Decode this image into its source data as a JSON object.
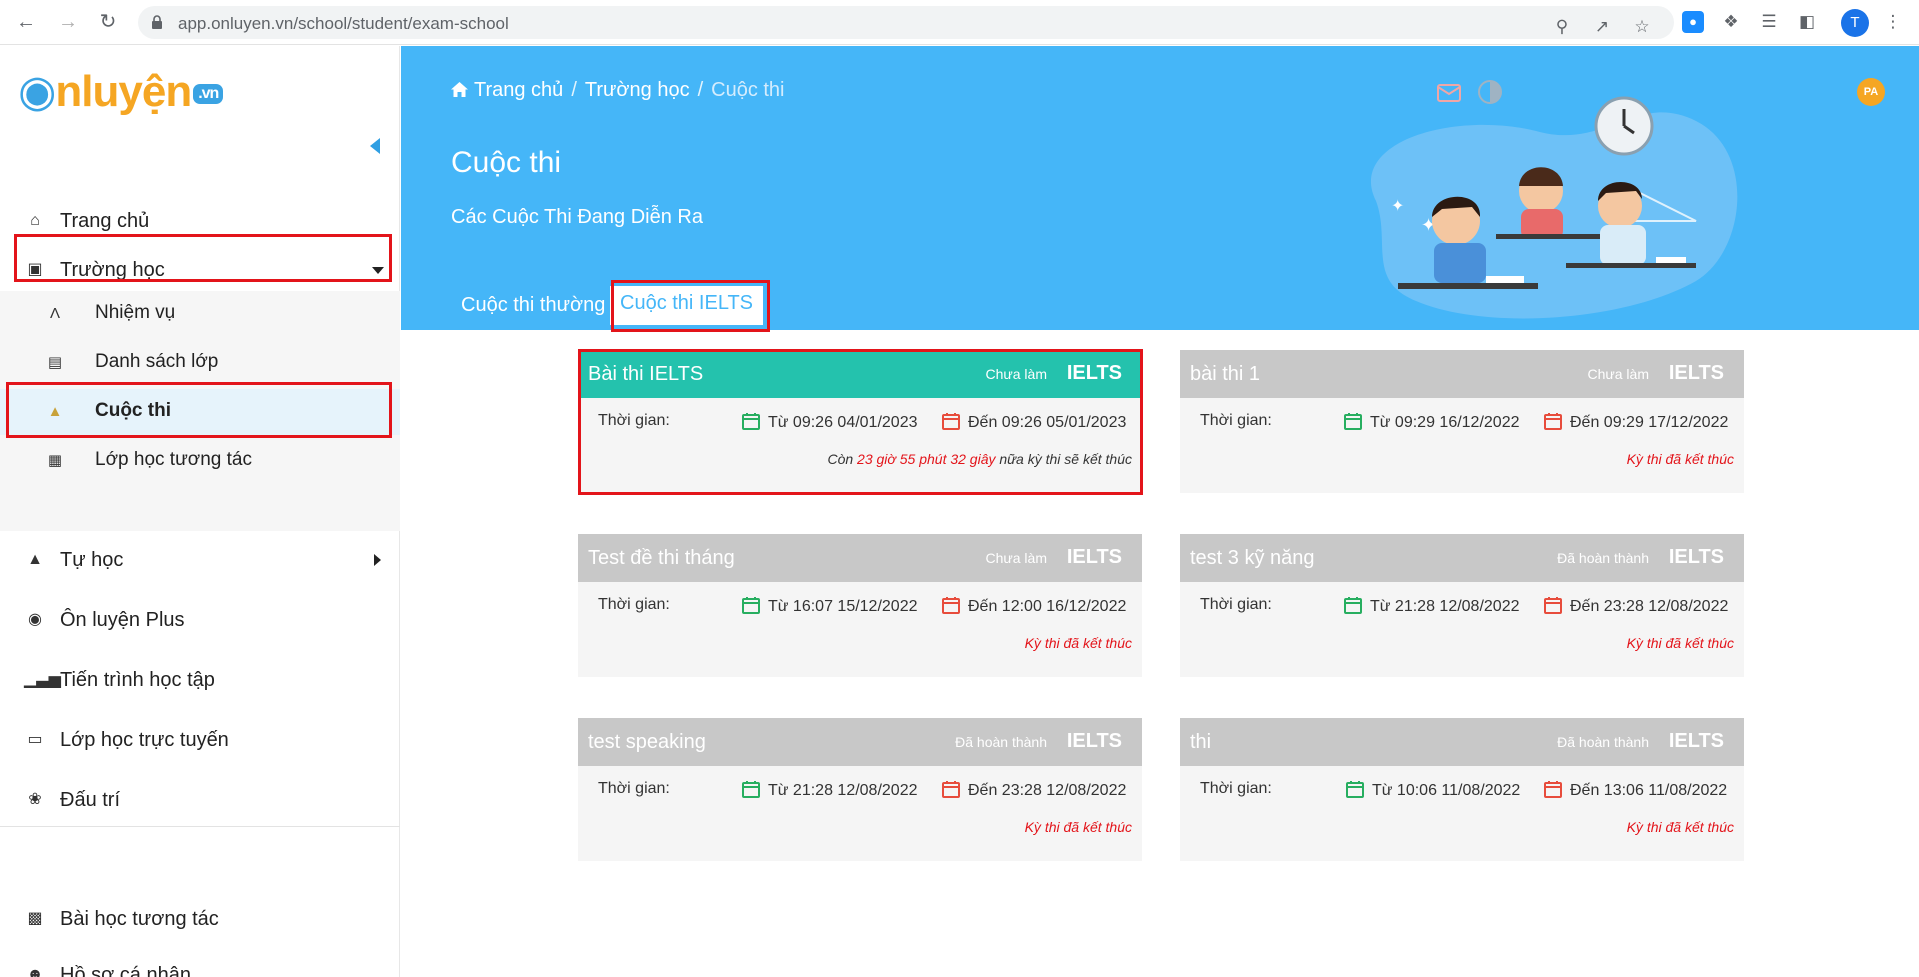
{
  "browser": {
    "url": "app.onluyen.vn/school/student/exam-school",
    "profile_initial": "T"
  },
  "sidebar": {
    "logo": {
      "text1": "nluyện",
      "text2": ".vn"
    },
    "items": [
      {
        "label": "Trang chủ"
      },
      {
        "label": "Trường học"
      },
      {
        "label": "Tự học"
      },
      {
        "label": "Ôn luyện Plus"
      },
      {
        "label": "Tiến trình học tập"
      },
      {
        "label": "Lớp học trực tuyến"
      },
      {
        "label": "Đấu trí"
      },
      {
        "label": "Bài học tương tác"
      },
      {
        "label": "Hồ sơ cá nhân"
      }
    ],
    "subitems": [
      {
        "label": "Nhiệm vụ"
      },
      {
        "label": "Danh sách lớp"
      },
      {
        "label": "Cuộc thi"
      },
      {
        "label": "Lớp học tương tác"
      }
    ]
  },
  "header": {
    "breadcrumb": [
      "Trang chủ",
      "Trường học",
      "Cuộc thi"
    ],
    "title": "Cuộc thi",
    "subtitle": "Các Cuộc Thi Đang Diễn Ra",
    "avatar": "PA"
  },
  "tabs": [
    {
      "label": "Cuộc thi thường"
    },
    {
      "label": "Cuộc thi IELTS"
    }
  ],
  "cards": [
    {
      "title": "Bài thi IELTS",
      "status": "Chưa làm",
      "type": "IELTS",
      "time_label": "Thời gian:",
      "from": "Từ 09:26 04/01/2023",
      "to": "Đến 09:26 05/01/2023",
      "note_prefix": "Còn ",
      "note_highlight": "23 giờ 55 phút 32 giây",
      "note_suffix": " nữa kỳ thi sẽ kết thúc"
    },
    {
      "title": "bài thi 1",
      "status": "Chưa làm",
      "type": "IELTS",
      "time_label": "Thời gian:",
      "from": "Từ 09:29 16/12/2022",
      "to": "Đến 09:29 17/12/2022",
      "note": "Kỳ thi đã kết thúc"
    },
    {
      "title": "Test đề thi tháng",
      "status": "Chưa làm",
      "type": "IELTS",
      "time_label": "Thời gian:",
      "from": "Từ 16:07 15/12/2022",
      "to": "Đến 12:00 16/12/2022",
      "note": "Kỳ thi đã kết thúc"
    },
    {
      "title": "test 3 kỹ năng",
      "status": "Đã hoàn thành",
      "type": "IELTS",
      "time_label": "Thời gian:",
      "from": "Từ 21:28 12/08/2022",
      "to": "Đến 23:28 12/08/2022",
      "note": "Kỳ thi đã kết thúc"
    },
    {
      "title": "test speaking",
      "status": "Đã hoàn thành",
      "type": "IELTS",
      "time_label": "Thời gian:",
      "from": "Từ 21:28 12/08/2022",
      "to": "Đến 23:28 12/08/2022",
      "note": "Kỳ thi đã kết thúc"
    },
    {
      "title": "thi",
      "status": "Đã hoàn thành",
      "type": "IELTS",
      "time_label": "Thời gian:",
      "from": "Từ 10:06 11/08/2022",
      "to": "Đến 13:06 11/08/2022",
      "note": "Kỳ thi đã kết thúc"
    }
  ],
  "colors": {
    "hero": "#45b6f8",
    "active_card": "#24c2ad",
    "inactive_card": "#c8c8c8",
    "highlight_box": "#e3141a",
    "calendar_start": "#27ae60",
    "calendar_end": "#e74c3c"
  }
}
